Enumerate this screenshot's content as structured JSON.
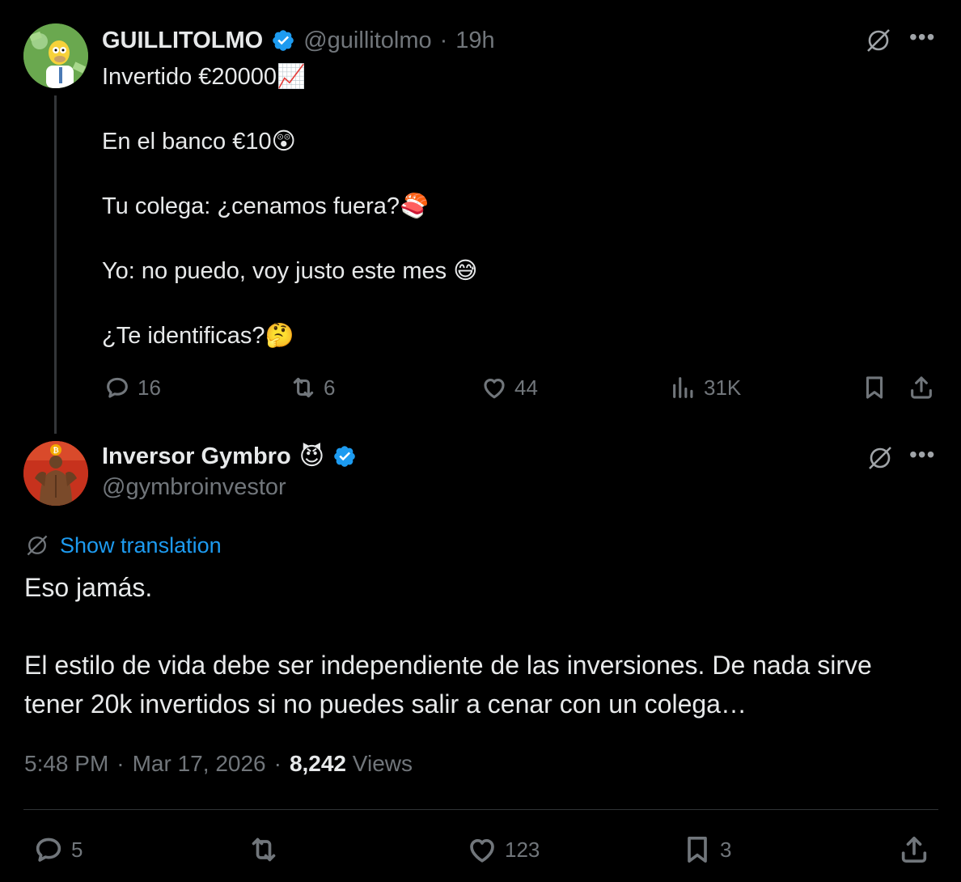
{
  "colors": {
    "background": "#000000",
    "text": "#e7e9ea",
    "muted": "#71767b",
    "link": "#1d9bf0",
    "verified": "#1d9bf0"
  },
  "parent_tweet": {
    "display_name": "GUILLITOLMO",
    "handle": "@guillitolmo",
    "separator": "·",
    "time": "19h",
    "lines": [
      {
        "text": "Invertido €20000",
        "emoji": "📈"
      },
      {
        "text": "En el banco €10",
        "emoji": "😲"
      },
      {
        "text": "Tu colega: ¿cenamos fuera?",
        "emoji": "🍣"
      },
      {
        "text": "Yo: no puedo, voy justo este mes ",
        "emoji": "😅"
      },
      {
        "text": "¿Te identificas?",
        "emoji": "🤔"
      }
    ],
    "actions": {
      "replies": "16",
      "reposts": "6",
      "likes": "44",
      "views": "31K"
    },
    "icons": [
      "verified-badge-icon",
      "grok-icon",
      "more-icon",
      "reply-icon",
      "repost-icon",
      "like-icon",
      "views-icon",
      "bookmark-icon",
      "share-icon"
    ]
  },
  "main_tweet": {
    "display_name": "Inversor Gymbro",
    "name_emoji": "😈",
    "handle": "@gymbroinvestor",
    "show_translation": "Show translation",
    "text_line1": "Eso jamás.",
    "text_line2": "El estilo de vida debe ser independiente de las inversiones. De nada sirve",
    "text_line3": "tener 20k invertidos si no puedes salir a cenar con un colega…",
    "time": "5:48 PM",
    "date": "Mar 17, 2026",
    "views_count": "8,242",
    "views_label": "Views",
    "separator": "·",
    "actions": {
      "replies": "5",
      "likes": "123",
      "bookmarks": "3"
    }
  }
}
